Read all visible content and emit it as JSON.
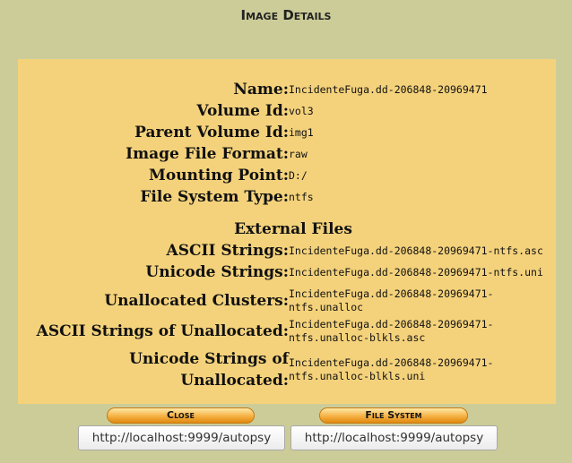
{
  "title": "Image Details",
  "details": [
    {
      "label": "Name:",
      "value": "IncidenteFuga.dd-206848-20969471"
    },
    {
      "label": "Volume Id:",
      "value": "vol3"
    },
    {
      "label": "Parent Volume Id:",
      "value": "img1"
    },
    {
      "label": "Image File Format:",
      "value": "raw"
    },
    {
      "label": "Mounting Point:",
      "value": "D:/"
    },
    {
      "label": "File System Type:",
      "value": "ntfs"
    }
  ],
  "external_files_heading": "External Files",
  "external_files": [
    {
      "label": "ASCII Strings:",
      "value": "IncidenteFuga.dd-206848-20969471-ntfs.asc"
    },
    {
      "label": "Unicode Strings:",
      "value": "IncidenteFuga.dd-206848-20969471-ntfs.uni"
    },
    {
      "label": "Unallocated Clusters:",
      "value1": "IncidenteFuga.dd-206848-20969471-",
      "value2": "ntfs.unalloc"
    },
    {
      "label": "ASCII Strings of Unallocated:",
      "value1": "IncidenteFuga.dd-206848-20969471-",
      "value2": "ntfs.unalloc-blkls.asc"
    },
    {
      "label": "Unicode Strings of Unallocated:",
      "value1": "IncidenteFuga.dd-206848-20969471-",
      "value2": "ntfs.unalloc-blkls.uni"
    }
  ],
  "buttons": {
    "close": "Close",
    "file_system": "File System"
  },
  "frame_urls": {
    "left": "http://localhost:9999/autopsy",
    "right": "http://localhost:9999/autopsy"
  }
}
